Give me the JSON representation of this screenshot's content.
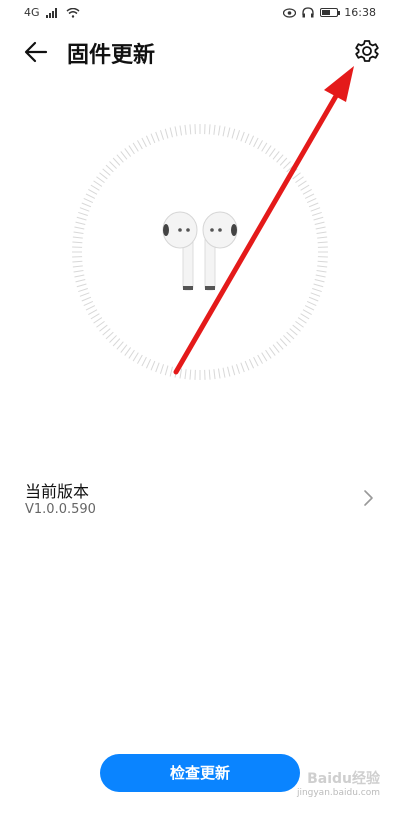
{
  "status_bar": {
    "network": "4G",
    "time": "16:38"
  },
  "header": {
    "title": "固件更新",
    "back_icon": "arrow-left-icon",
    "settings_icon": "gear-icon"
  },
  "hero": {
    "image": "earbuds-illustration"
  },
  "version": {
    "label": "当前版本",
    "value": "V1.0.0.590",
    "chevron_icon": "chevron-right-icon"
  },
  "actions": {
    "check_update_label": "检查更新"
  },
  "watermark": {
    "logo_text": "Baidu经验",
    "url": "jingyan.baidu.com"
  },
  "colors": {
    "primary": "#0a84ff",
    "annotation_arrow": "#e41a1a"
  }
}
